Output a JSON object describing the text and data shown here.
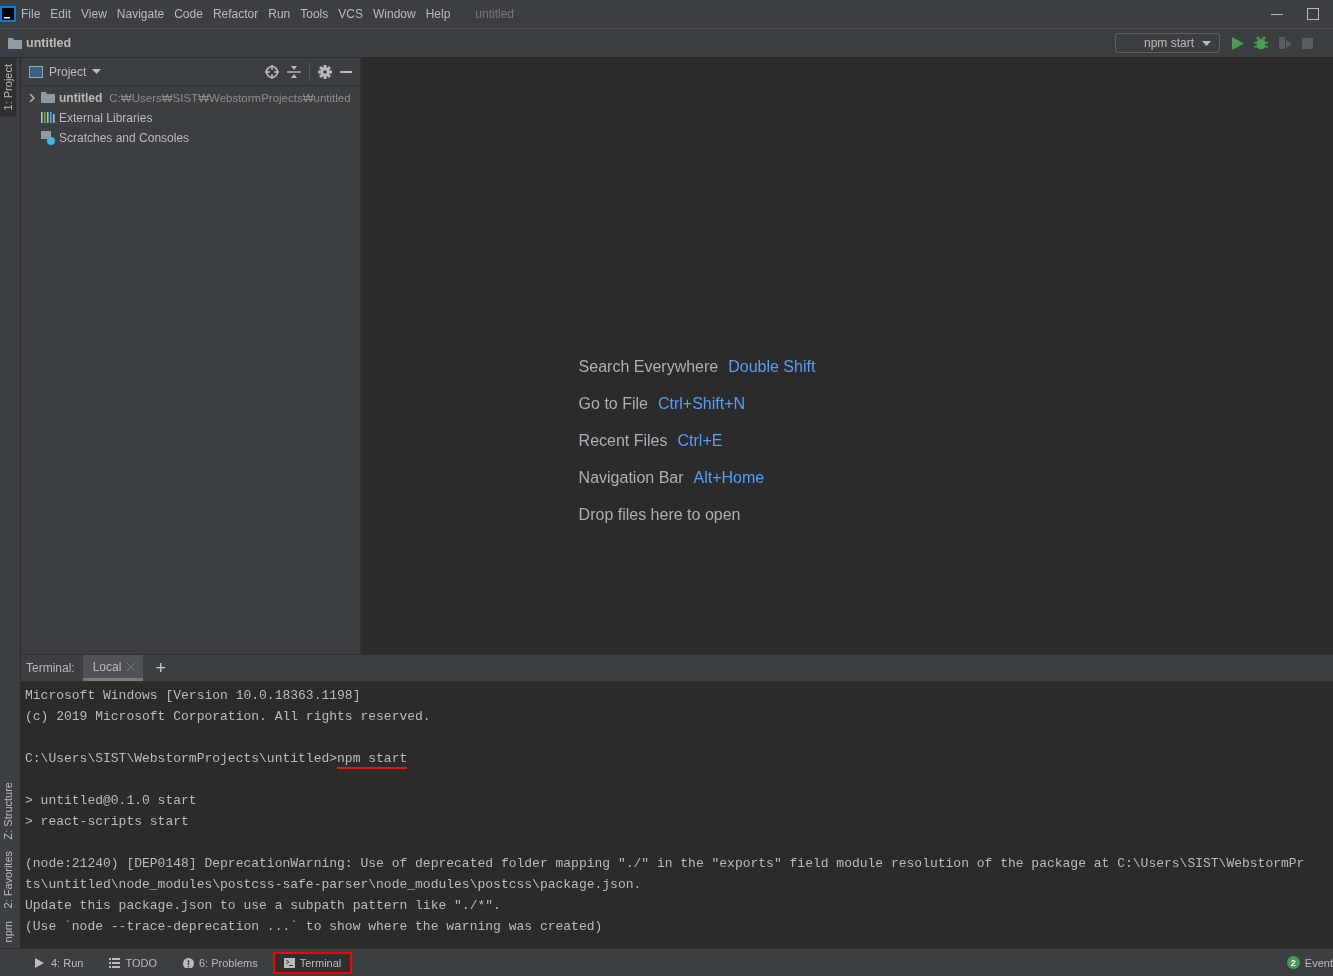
{
  "menu": [
    "File",
    "Edit",
    "View",
    "Navigate",
    "Code",
    "Refactor",
    "Run",
    "Tools",
    "VCS",
    "Window",
    "Help"
  ],
  "window": {
    "title": "untitled"
  },
  "breadcrumb": "untitled",
  "run_config": "npm start",
  "left_stripe_top": [
    {
      "label": "1: Project",
      "selected": true
    }
  ],
  "left_stripe_bottom": [
    {
      "label": "Z: Structure",
      "selected": false
    },
    {
      "label": "2: Favorites",
      "selected": false
    },
    {
      "label": "npm",
      "selected": false
    }
  ],
  "project_panel": {
    "title": "Project",
    "tree": [
      {
        "kind": "folder",
        "name": "untitled",
        "path": "C:₩Users₩SIST₩WebstormProjects₩untitled",
        "expanded": false
      },
      {
        "kind": "libraries",
        "name": "External Libraries"
      },
      {
        "kind": "scratches",
        "name": "Scratches and Consoles"
      }
    ]
  },
  "editor_hints": [
    {
      "label": "Search Everywhere",
      "shortcut": "Double Shift"
    },
    {
      "label": "Go to File",
      "shortcut": "Ctrl+Shift+N"
    },
    {
      "label": "Recent Files",
      "shortcut": "Ctrl+E"
    },
    {
      "label": "Navigation Bar",
      "shortcut": "Alt+Home"
    },
    {
      "label": "Drop files here to open"
    }
  ],
  "terminal": {
    "title": "Terminal:",
    "tabs": [
      {
        "label": "Local",
        "selected": true
      }
    ],
    "add": "+",
    "blocks": [
      {
        "lines": [
          {
            "text": "Microsoft Windows [Version 10.0.18363.1198]"
          },
          {
            "text": "(c) 2019 Microsoft Corporation. All rights reserved."
          }
        ]
      },
      {
        "lines": [
          {
            "text": "C:\\Users\\SIST\\WebstormProjects\\untitled>",
            "command": "npm start",
            "annotated": true
          }
        ]
      },
      {
        "lines": [
          {
            "text": "> untitled@0.1.0 start"
          },
          {
            "text": "> react-scripts start"
          }
        ]
      },
      {
        "lines": [
          {
            "text": "(node:21240) [DEP0148] DeprecationWarning: Use of deprecated folder mapping \"./\" in the \"exports\" field module resolution of the package at C:\\Users\\SIST\\WebstormPr"
          },
          {
            "text": "ts\\untitled\\node_modules\\postcss-safe-parser\\node_modules\\postcss\\package.json."
          },
          {
            "text": "Update this package.json to use a subpath pattern like \"./*\"."
          },
          {
            "text": "(Use `node --trace-deprecation ...` to show where the warning was created)"
          }
        ]
      }
    ]
  },
  "bottom_tabs": [
    {
      "kind": "run",
      "label": "4: Run",
      "selected": false
    },
    {
      "kind": "todo",
      "label": "TODO",
      "selected": false
    },
    {
      "kind": "problems",
      "label": "6: Problems",
      "selected": false
    },
    {
      "kind": "terminal",
      "label": "Terminal",
      "selected": true
    }
  ],
  "event_log": {
    "count": "2",
    "label": "Event"
  }
}
